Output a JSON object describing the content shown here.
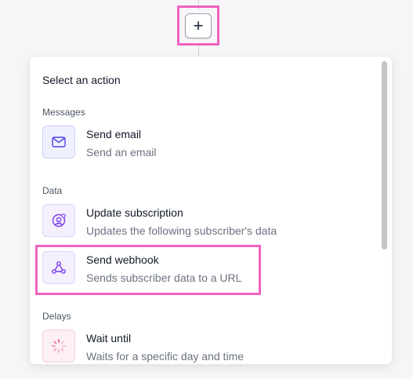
{
  "add_button": {
    "label": "+",
    "icon": "plus-icon"
  },
  "panel": {
    "title": "Select an action",
    "sections": [
      {
        "label": "Messages",
        "items": [
          {
            "title": "Send email",
            "subtitle": "Send an email",
            "icon": "mail-icon"
          }
        ]
      },
      {
        "label": "Data",
        "items": [
          {
            "title": "Update subscription",
            "subtitle": "Updates the following subscriber's data",
            "icon": "user-settings-icon"
          },
          {
            "title": "Send webhook",
            "subtitle": "Sends subscriber data to a URL",
            "icon": "webhook-icon"
          }
        ]
      },
      {
        "label": "Delays",
        "items": [
          {
            "title": "Wait until",
            "subtitle": "Waits for a specific day and time",
            "icon": "spinner-icon"
          }
        ]
      }
    ]
  },
  "colors": {
    "highlight": "#f062c0",
    "email_icon": "#4f46e5",
    "data_icon": "#7c3aed",
    "delay_icon": "#ec4899"
  }
}
